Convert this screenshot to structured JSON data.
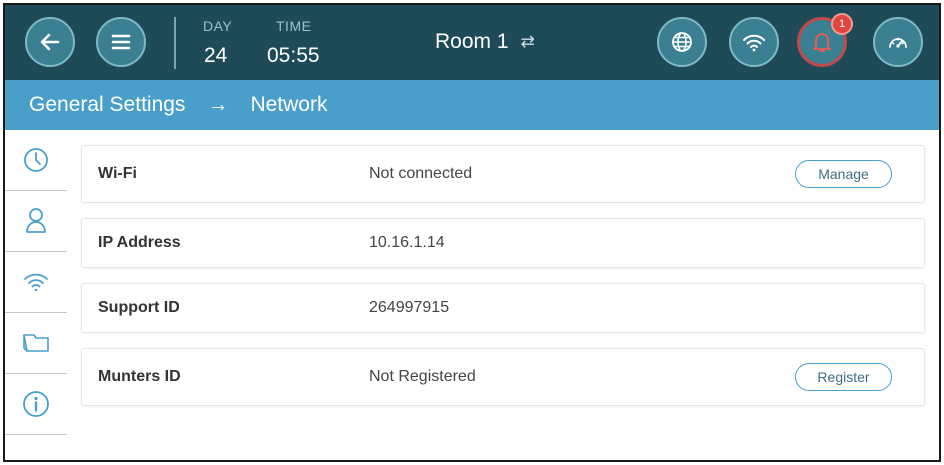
{
  "header": {
    "day_label": "DAY",
    "day_value": "24",
    "time_label": "TIME",
    "time_value": "05:55",
    "room_name": "Room 1",
    "alarm_count": "1",
    "icons": [
      "back-arrow-icon",
      "menu-icon",
      "globe-icon",
      "wifi-icon",
      "bell-icon",
      "gauge-icon",
      "swap-icon"
    ]
  },
  "breadcrumb": {
    "parent": "General Settings",
    "separator": "→",
    "current": "Network"
  },
  "sidebar": {
    "items": [
      {
        "icon": "clock-icon"
      },
      {
        "icon": "user-icon"
      },
      {
        "icon": "wifi-icon",
        "active": true
      },
      {
        "icon": "folder-icon"
      },
      {
        "icon": "info-icon"
      }
    ]
  },
  "rows": [
    {
      "label": "Wi-Fi",
      "value": "Not connected",
      "button": "Manage"
    },
    {
      "label": "IP Address",
      "value": "10.16.1.14"
    },
    {
      "label": "Support ID",
      "value": "264997915"
    },
    {
      "label": "Munters ID",
      "value": "Not Registered",
      "button": "Register"
    }
  ],
  "colors": {
    "header_bg": "#1f4a58",
    "button_bg": "#3a7f92",
    "breadcrumb_bg": "#4a9fca",
    "accent": "#4a9fca",
    "alarm": "#e0463e"
  }
}
